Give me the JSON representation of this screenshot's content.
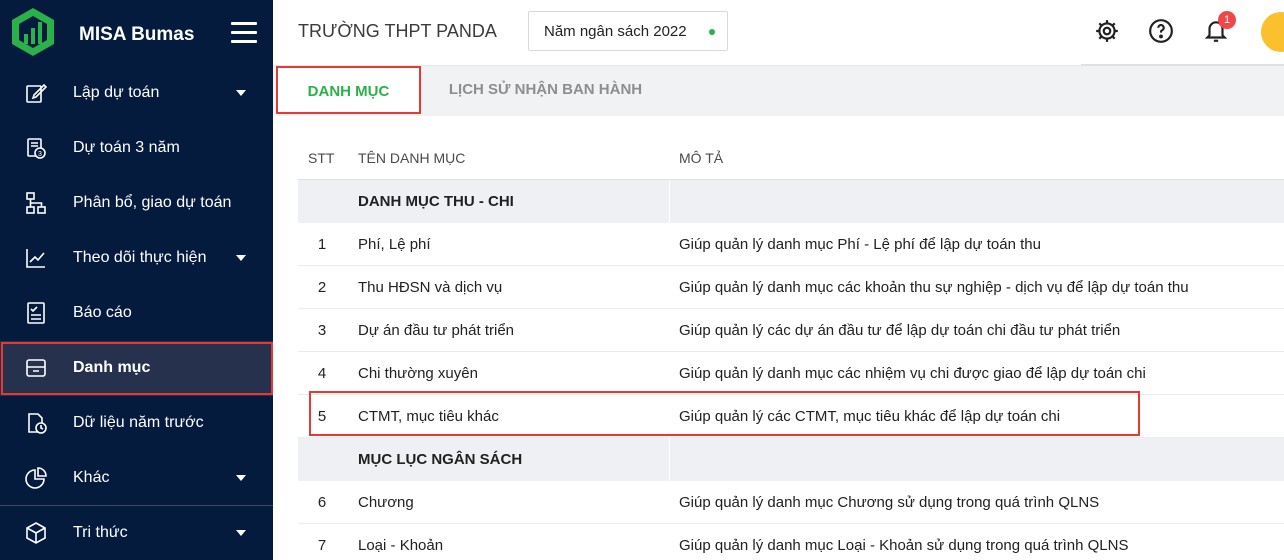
{
  "app": {
    "name": "MISA Bumas"
  },
  "colors": {
    "sidebar": "#041b3e",
    "accent_green": "#2bb14a",
    "highlight_red": "#e53935",
    "badge_red": "#f04848"
  },
  "sidebar": {
    "items": [
      {
        "label": "Lập dự toán",
        "icon": "edit-icon",
        "has_caret": true
      },
      {
        "label": "Dự toán 3 năm",
        "icon": "budget-3-year-icon",
        "has_caret": false
      },
      {
        "label": "Phân bổ, giao dự toán",
        "icon": "hierarchy-icon",
        "has_caret": false
      },
      {
        "label": "Theo dõi thực hiện",
        "icon": "line-chart-icon",
        "has_caret": true
      },
      {
        "label": "Báo cáo",
        "icon": "report-icon",
        "has_caret": false
      },
      {
        "label": "Danh mục",
        "icon": "folder-icon",
        "has_caret": false,
        "active": true
      },
      {
        "label": "Dữ liệu năm trước",
        "icon": "history-doc-icon",
        "has_caret": false
      },
      {
        "label": "Khác",
        "icon": "pie-chart-icon",
        "has_caret": true
      },
      {
        "label": "Tri thức",
        "icon": "cube-icon",
        "has_caret": true
      }
    ]
  },
  "header": {
    "school": "TRƯỜNG THPT PANDA",
    "budget_year": "Năm ngân sách 2022",
    "notification_count": "1"
  },
  "tabs": [
    {
      "label": "DANH MỤC",
      "active": true
    },
    {
      "label": "LỊCH SỬ NHẬN BAN HÀNH",
      "active": false
    }
  ],
  "table": {
    "headers": [
      "STT",
      "TÊN DANH MỤC",
      "MÔ TẢ"
    ],
    "rows": [
      {
        "stt": "",
        "name": "DANH MỤC THU - CHI",
        "desc": "",
        "group": true
      },
      {
        "stt": "1",
        "name": "Phí, Lệ phí",
        "desc": "Giúp quản lý danh mục Phí - Lệ phí để lập dự toán thu"
      },
      {
        "stt": "2",
        "name": "Thu HĐSN và dịch vụ",
        "desc": "Giúp quản lý danh mục các khoản thu sự nghiệp - dịch vụ để lập dự toán thu"
      },
      {
        "stt": "3",
        "name": "Dự án đầu tư phát triển",
        "desc": "Giúp quản lý các dự án đầu tư để lập dự toán chi đầu tư phát triển"
      },
      {
        "stt": "4",
        "name": "Chi thường xuyên",
        "desc": "Giúp quản lý danh mục các nhiệm vụ chi được giao để lập dự toán chi"
      },
      {
        "stt": "5",
        "name": "CTMT, mục tiêu khác",
        "desc": "Giúp quản lý các CTMT, mục tiêu khác để lập dự toán chi",
        "highlighted": true
      },
      {
        "stt": "",
        "name": "MỤC LỤC NGÂN SÁCH",
        "desc": "",
        "group": true
      },
      {
        "stt": "6",
        "name": "Chương",
        "desc": "Giúp quản lý danh mục Chương sử dụng trong quá trình QLNS"
      },
      {
        "stt": "7",
        "name": "Loại - Khoản",
        "desc": "Giúp quản lý danh mục Loại - Khoản sử dụng trong quá trình QLNS"
      }
    ]
  }
}
